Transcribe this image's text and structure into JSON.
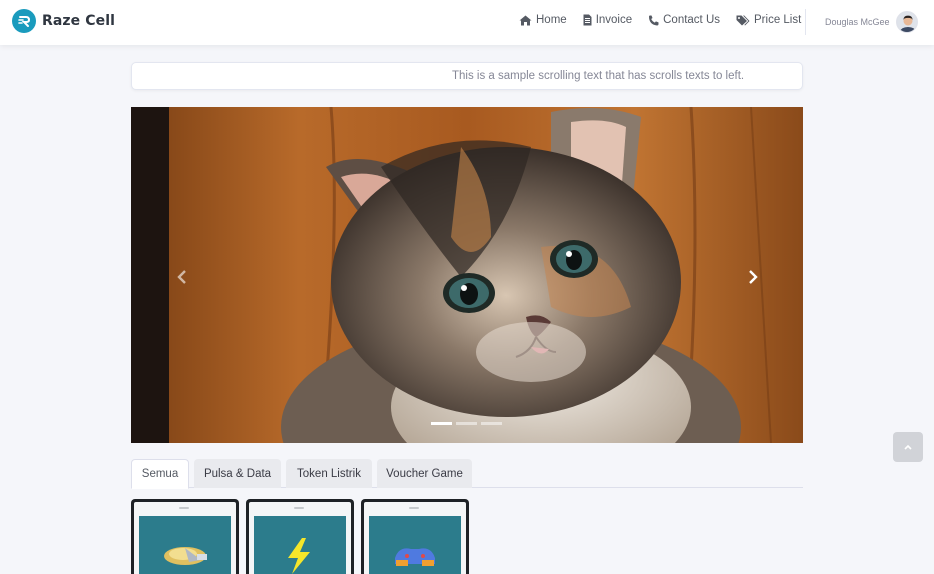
{
  "brand": {
    "name": "Raze Cell",
    "logo_icon": "razecell-logo-icon",
    "color": "#1a9bbd"
  },
  "nav": {
    "links": [
      {
        "label": "Home",
        "icon": "home-icon"
      },
      {
        "label": "Invoice",
        "icon": "file-invoice-icon"
      },
      {
        "label": "Contact Us",
        "icon": "phone-icon"
      },
      {
        "label": "Price List",
        "icon": "tags-icon"
      }
    ],
    "user": {
      "name": "Douglas McGee",
      "avatar_icon": "user-avatar-icon"
    }
  },
  "marquee": {
    "text": "This is a sample scrolling text that has scrolls texts to left."
  },
  "carousel": {
    "image_alt": "kitten",
    "slide_count": 3,
    "active_slide": 1,
    "prev_icon": "chevron-left-icon",
    "next_icon": "chevron-right-icon"
  },
  "tabs": [
    {
      "label": "Semua",
      "active": true
    },
    {
      "label": "Pulsa & Data",
      "active": false
    },
    {
      "label": "Token Listrik",
      "active": false
    },
    {
      "label": "Voucher Game",
      "active": false
    }
  ],
  "cards": [
    {
      "icon": "pulsa-data-icon"
    },
    {
      "icon": "lightning-token-icon"
    },
    {
      "icon": "game-controller-icon"
    }
  ],
  "scroll_top": {
    "icon": "chevron-up-icon"
  }
}
